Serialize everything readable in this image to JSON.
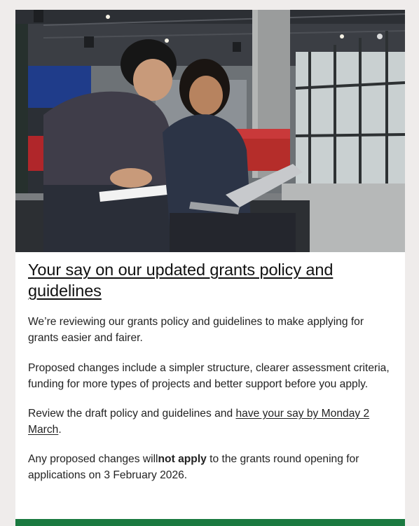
{
  "hero": {
    "alt": "Two students sitting together looking at a laptop and notebook"
  },
  "article": {
    "title": "Your say on our updated grants policy and guidelines",
    "paragraph1": "We’re reviewing our grants policy and guidelines to make applying for grants easier and fairer.",
    "paragraph2": "Proposed changes include a simpler structure, clearer assessment criteria, funding for more types of projects and better support before you apply.",
    "paragraph3_prefix": "Review the draft policy and guidelines and ",
    "paragraph3_link": "have your say by Monday 2 March",
    "paragraph3_suffix": ".",
    "paragraph4_prefix": "Any proposed changes will",
    "paragraph4_bold": "not apply",
    "paragraph4_suffix": " to the grants round opening for applications on 3 February 2026."
  },
  "colors": {
    "accent_green": "#1a7a40",
    "page_background": "#efeceb"
  }
}
